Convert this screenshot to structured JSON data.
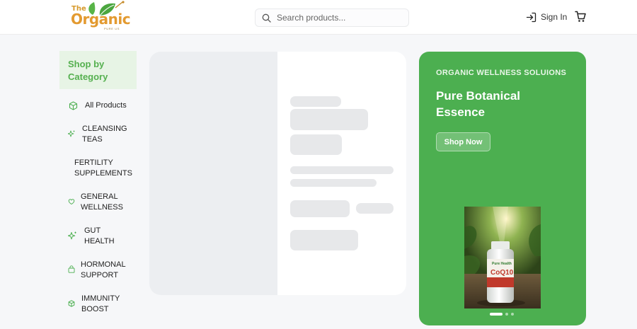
{
  "header": {
    "logo": {
      "the": "The",
      "organic": "Organic",
      "tagline": "PURE US"
    },
    "search": {
      "placeholder": "Search products..."
    },
    "sign_in_label": "Sign In"
  },
  "sidebar": {
    "heading": "Shop by\nCategory",
    "items": [
      {
        "label": "All Products",
        "icon": "box-icon"
      },
      {
        "label": "CLEANSING\nTEAS",
        "icon": "sparkle-icon"
      },
      {
        "label": "FERTILITY\nSUPPLEMENTS",
        "icon": ""
      },
      {
        "label": "GENERAL\nWELLNESS",
        "icon": "heart-icon"
      },
      {
        "label": "GUT\nHEALTH",
        "icon": "sparkle-icon"
      },
      {
        "label": "HORMONAL\nSUPPORT",
        "icon": "bag-icon"
      },
      {
        "label": "IMMUNITY\nBOOST",
        "icon": "box-icon"
      }
    ]
  },
  "promo": {
    "eyebrow": "ORGANIC WELLNESS SOLUIONS",
    "title": "Pure Botanical Essence",
    "button_label": "Shop Now",
    "product_brand": "Pure Health",
    "product_name": "CoQ10",
    "slide_count": 3,
    "active_slide": 1
  },
  "colors": {
    "brand_green": "#4caf50",
    "category_header_bg": "#e7f4e5",
    "logo_orange": "#e39a30",
    "skeleton": "#e7e8ea"
  }
}
